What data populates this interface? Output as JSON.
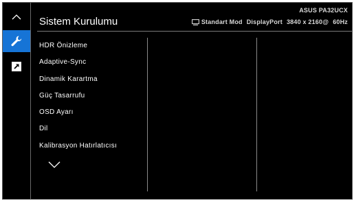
{
  "header": {
    "title": "Sistem Kurulumu",
    "model": "ASUS PA32UCX",
    "mode": "Standart Mod",
    "input": "DisplayPort",
    "resolution": "3840 x 2160@",
    "refresh": "60Hz"
  },
  "sidebar": {
    "icons": [
      "chevron-up-icon",
      "wrench-icon",
      "shortcut-arrow-icon"
    ],
    "active": "wrench-icon",
    "accent": "#1674d6"
  },
  "menu": {
    "items": [
      "HDR Önizleme",
      "Adaptive-Sync",
      "Dinamik Karartma",
      "Güç Tasarrufu",
      "OSD Ayarı",
      "Dil",
      "Kalibrasyon Hatırlatıcısı"
    ],
    "more_icon": "chevron-down-icon"
  }
}
